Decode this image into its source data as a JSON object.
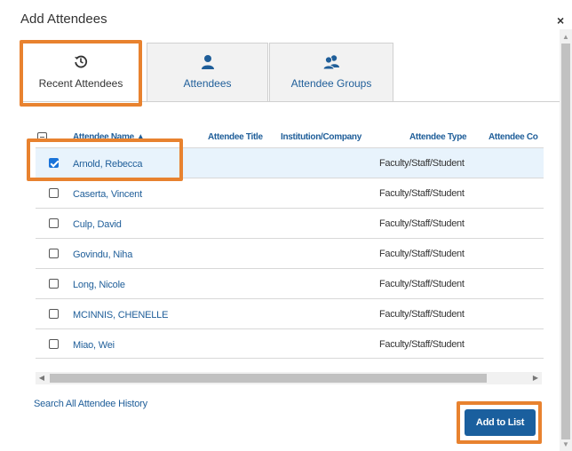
{
  "dialog": {
    "title": "Add Attendees",
    "close_label": "×"
  },
  "tabs": [
    {
      "label": "Recent Attendees",
      "icon": "history-icon",
      "active": true
    },
    {
      "label": "Attendees",
      "icon": "person-icon",
      "active": false
    },
    {
      "label": "Attendee Groups",
      "icon": "people-group-icon",
      "active": false
    }
  ],
  "table": {
    "columns": [
      "Attendee Name ▲",
      "Attendee Title",
      "Institution/Company",
      "Attendee Type",
      "Attendee Co"
    ],
    "rows": [
      {
        "name": "Arnold, Rebecca",
        "type": "Faculty/Staff/Student",
        "checked": true
      },
      {
        "name": "Caserta, Vincent",
        "type": "Faculty/Staff/Student",
        "checked": false
      },
      {
        "name": "Culp, David",
        "type": "Faculty/Staff/Student",
        "checked": false
      },
      {
        "name": "Govindu, Niha",
        "type": "Faculty/Staff/Student",
        "checked": false
      },
      {
        "name": "Long, Nicole",
        "type": "Faculty/Staff/Student",
        "checked": false
      },
      {
        "name": "MCINNIS, CHENELLE",
        "type": "Faculty/Staff/Student",
        "checked": false
      },
      {
        "name": "Miao, Wei",
        "type": "Faculty/Staff/Student",
        "checked": false
      }
    ]
  },
  "footer": {
    "history_link": "Search All Attendee History",
    "add_button": "Add to List"
  },
  "colors": {
    "link_blue": "#1f5e99",
    "button_blue": "#1a5f9e",
    "highlight_orange": "#e8822f",
    "selected_row": "#e8f3fc"
  }
}
